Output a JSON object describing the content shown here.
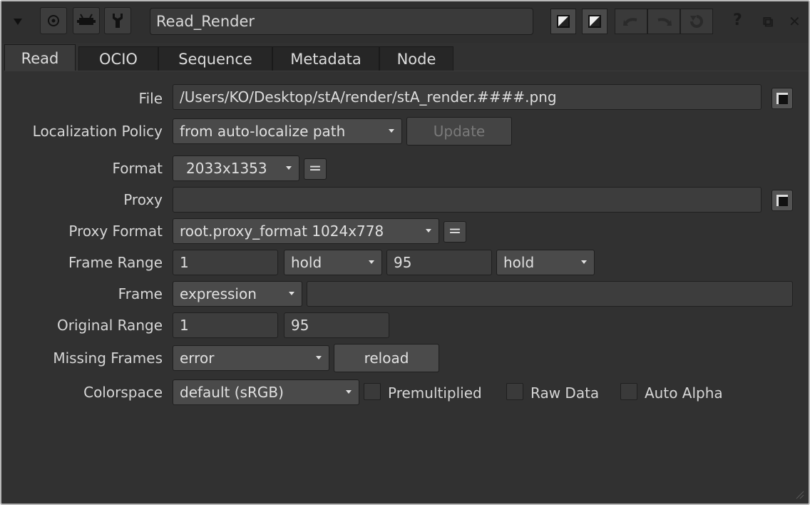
{
  "titlebar": {
    "node_name": "Read_Render",
    "icons": {
      "collapse": "triangle-down-icon",
      "center": "circle-target-icon",
      "viewer": "viewer-icon",
      "settings": "wrench-icon",
      "swatch_a": "color-swatch-icon",
      "swatch_b": "color-swatch-icon",
      "undo": "undo-icon",
      "redo": "redo-icon",
      "revert": "revert-icon"
    },
    "help_glyph": "?",
    "float_glyph": "⧉",
    "close_glyph": "✕"
  },
  "tabs": [
    "Read",
    "OCIO",
    "Sequence",
    "Metadata",
    "Node"
  ],
  "form": {
    "file_label": "File",
    "file_value": "/Users/KO/Desktop/stA/render/stA_render.####.png",
    "localization_label": "Localization Policy",
    "localization_value": "from auto-localize path",
    "update_button": "Update",
    "format_label": "Format",
    "format_value": "2033x1353",
    "eq_symbol": "=",
    "proxy_label": "Proxy",
    "proxy_value": "",
    "proxy_format_label": "Proxy Format",
    "proxy_format_value": "root.proxy_format 1024x778",
    "frame_range_label": "Frame Range",
    "frame_range_start": "1",
    "frame_range_before": "hold",
    "frame_range_end": "95",
    "frame_range_after": "hold",
    "frame_label": "Frame",
    "frame_mode": "expression",
    "frame_value": "",
    "original_range_label": "Original Range",
    "original_range_start": "1",
    "original_range_end": "95",
    "missing_frames_label": "Missing Frames",
    "missing_frames_value": "error",
    "reload_button": "reload",
    "colorspace_label": "Colorspace",
    "colorspace_value": "default (sRGB)",
    "premultiplied_label": "Premultiplied",
    "raw_data_label": "Raw Data",
    "auto_alpha_label": "Auto Alpha"
  },
  "colors": {
    "panel_bg": "#313131",
    "field_bg": "#3d3d3d",
    "button_bg": "#4b4b4b",
    "text": "#dcdcdc"
  }
}
